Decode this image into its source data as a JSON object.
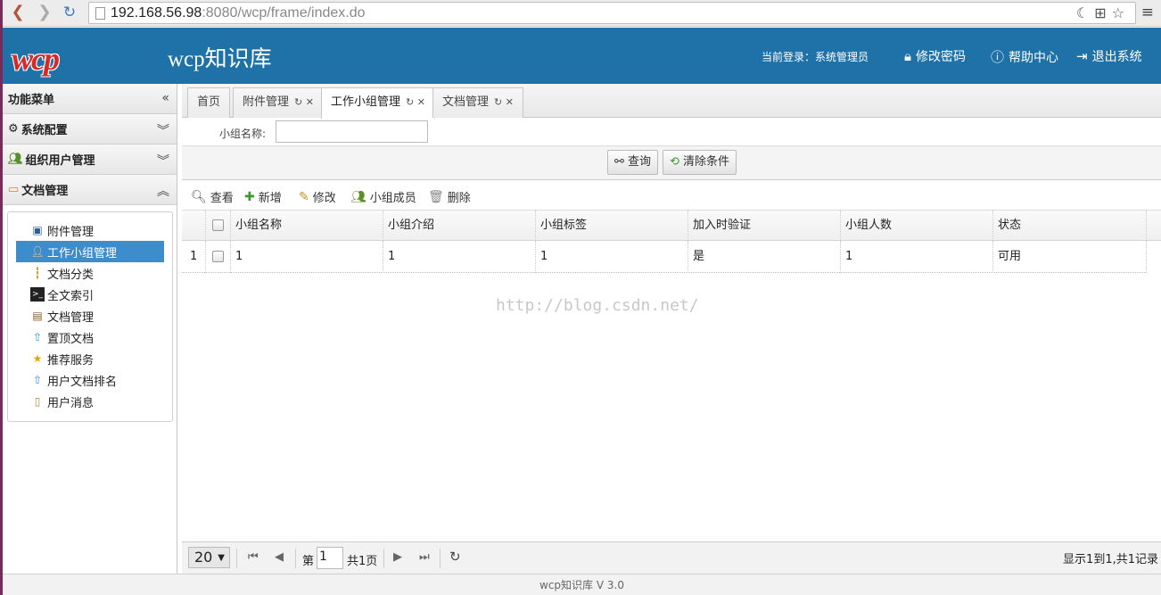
{
  "browser": {
    "url_host": "192.168.56.98",
    "url_rest": ":8080/wcp/frame/index.do"
  },
  "header": {
    "logo": "wcp",
    "title": "wcp知识库",
    "login_label": "当前登录：系统管理员",
    "change_password": "修改密码",
    "help_center": "帮助中心",
    "logout": "退出系统"
  },
  "sidebar": {
    "title": "功能菜单",
    "groups": [
      {
        "label": "系统配置"
      },
      {
        "label": "组织用户管理"
      },
      {
        "label": "文档管理"
      }
    ],
    "items": [
      {
        "label": "附件管理",
        "icon": "save-icon"
      },
      {
        "label": "工作小组管理",
        "icon": "user-group-icon"
      },
      {
        "label": "文档分类",
        "icon": "folder-tree-icon"
      },
      {
        "label": "全文索引",
        "icon": "terminal-icon"
      },
      {
        "label": "文档管理",
        "icon": "document-icon"
      },
      {
        "label": "置顶文档",
        "icon": "arrow-up-icon"
      },
      {
        "label": "推荐服务",
        "icon": "star-icon"
      },
      {
        "label": "用户文档排名",
        "icon": "arrow-up-icon"
      },
      {
        "label": "用户消息",
        "icon": "note-icon"
      }
    ]
  },
  "tabs": [
    {
      "label": "首页"
    },
    {
      "label": "附件管理"
    },
    {
      "label": "工作小组管理"
    },
    {
      "label": "文档管理"
    }
  ],
  "search": {
    "label": "小组名称:",
    "value": ""
  },
  "buttons": {
    "query": "查询",
    "clear": "清除条件"
  },
  "toolbar": {
    "view": "查看",
    "add": "新增",
    "edit": "修改",
    "members": "小组成员",
    "delete": "删除"
  },
  "table": {
    "columns": [
      "小组名称",
      "小组介绍",
      "小组标签",
      "加入时验证",
      "小组人数",
      "状态"
    ],
    "rows": [
      {
        "num": "1",
        "cells": [
          "1",
          "1",
          "1",
          "是",
          "1",
          "可用"
        ]
      }
    ]
  },
  "watermark": "http://blog.csdn.net/",
  "pager": {
    "page_size": "20",
    "page_prefix": "第",
    "page_value": "1",
    "page_total": "共1页",
    "info": "显示1到1,共1记录"
  },
  "footer": "wcp知识库  V 3.0",
  "colors": {
    "header_bg": "#1e72a8",
    "active_item": "#3d8ccc",
    "logo": "#d82828"
  }
}
